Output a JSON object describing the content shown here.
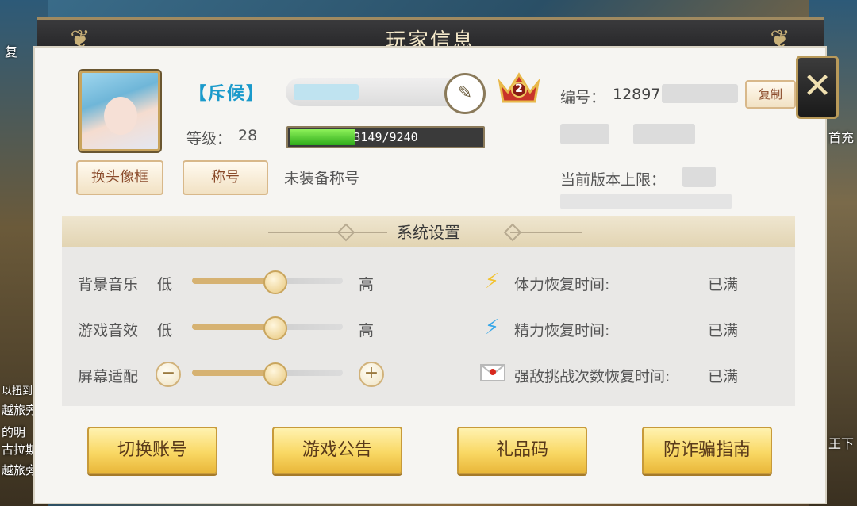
{
  "background": {
    "left_texts": [
      "复",
      "以扭到",
      "越旅旁",
      "的明",
      "古拉斯",
      "越旅旁"
    ],
    "right_texts": [
      "首充",
      "王下"
    ]
  },
  "window": {
    "title": "玩家信息",
    "close_symbol": "✕"
  },
  "player": {
    "title_tag": "【斥候】",
    "level_label": "等级：",
    "level_value": "28",
    "exp_text": "3149/9240",
    "exp_current": 3149,
    "exp_max": 9240,
    "vip_level": "2",
    "id_label": "编号：",
    "id_value": "128977",
    "copy_label": "复制",
    "version_cap_label": "当前版本上限：",
    "change_avatar_frame_label": "换头像框",
    "title_button_label": "称号",
    "no_title_text": "未装备称号",
    "edit_icon": "pencil-icon"
  },
  "settings": {
    "section_title": "系统设置",
    "music": {
      "label": "背景音乐",
      "min_label": "低",
      "max_label": "高",
      "level": 0.55
    },
    "sfx": {
      "label": "游戏音效",
      "min_label": "低",
      "max_label": "高",
      "level": 0.55
    },
    "screen": {
      "label": "屏幕适配",
      "minus": "−",
      "plus": "+",
      "level": 0.55
    }
  },
  "recovery": {
    "stamina": {
      "label": "体力恢复时间:",
      "value": "已满",
      "icon": "yellow-bolt-icon"
    },
    "energy": {
      "label": "精力恢复时间:",
      "value": "已满",
      "icon": "blue-bolt-icon"
    },
    "challenge": {
      "label": "强敌挑战次数恢复时间:",
      "value": "已满",
      "icon": "envelope-icon"
    }
  },
  "buttons": {
    "switch_account": "切换账号",
    "announcement": "游戏公告",
    "gift_code": "礼品码",
    "anti_fraud": "防诈骗指南"
  },
  "colors": {
    "accent_gold": "#f9d864",
    "title_blue": "#1a9acb",
    "exp_green": "#2eab1a"
  }
}
